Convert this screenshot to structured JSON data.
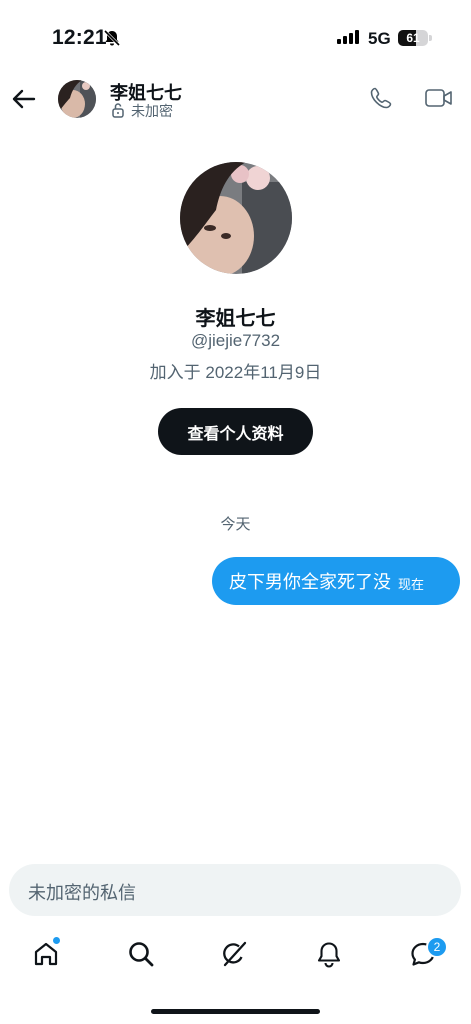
{
  "status_bar": {
    "time": "12:21",
    "network": "5G",
    "battery": "61",
    "battery_percent": 61
  },
  "header": {
    "name": "李姐七七",
    "encryption": "未加密"
  },
  "profile": {
    "name": "李姐七七",
    "handle": "@jiejie7732",
    "joined": "加入于 2022年11月9日",
    "view_profile_label": "查看个人资料"
  },
  "conversation": {
    "day_label": "今天",
    "messages": [
      {
        "text": "皮下男你全家死了没",
        "time": "现在",
        "sender": "me"
      }
    ]
  },
  "composer": {
    "placeholder": "未加密的私信"
  },
  "bottom_nav": {
    "items": [
      "home",
      "search",
      "grok",
      "notifications",
      "messages"
    ],
    "messages_badge": "2"
  },
  "colors": {
    "accent": "#1d9bf0",
    "text": "#0f1419",
    "secondary": "#536471",
    "composer_bg": "#eff3f4"
  }
}
